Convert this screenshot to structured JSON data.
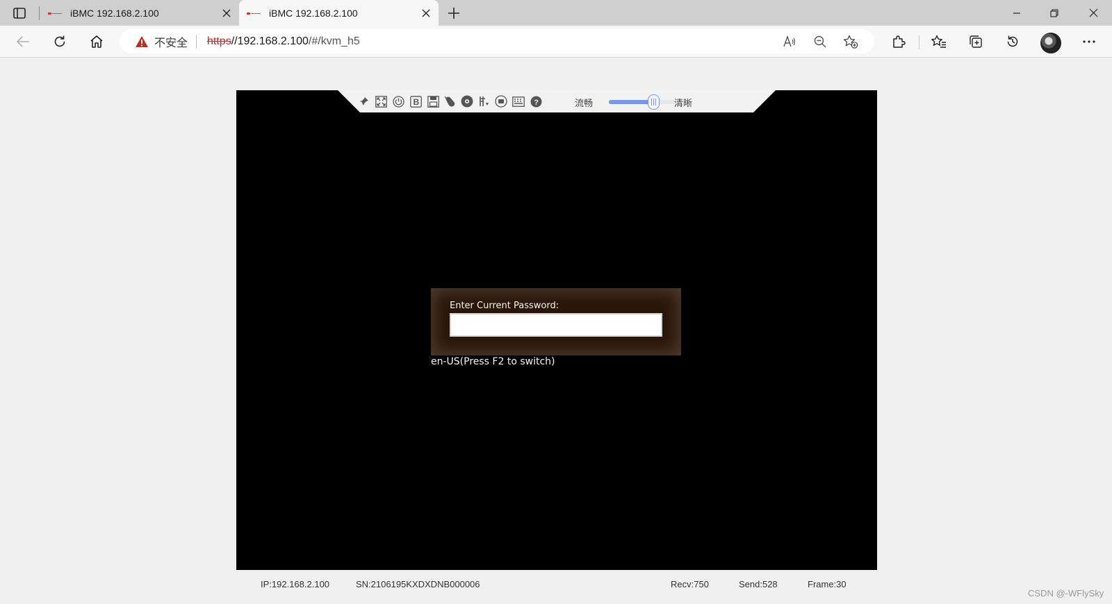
{
  "browser": {
    "tabs": [
      {
        "title": "iBMC 192.168.2.100",
        "active": false
      },
      {
        "title": "iBMC 192.168.2.100",
        "active": true
      }
    ],
    "address": {
      "security_label": "不安全",
      "url_scheme": "https",
      "url_host": "//192.168.2.100",
      "url_path": "/#/kvm_h5"
    }
  },
  "kvm": {
    "toolbar": {
      "icons": [
        "pin-icon",
        "fullscreen-icon",
        "power-icon",
        "boot-option-icon",
        "floppy-icon",
        "mouse-icon",
        "cd-icon",
        "screen-capture-icon",
        "record-icon",
        "keyboard-icon",
        "help-icon"
      ],
      "quality_left_label": "流畅",
      "quality_right_label": "清晰",
      "quality_level_percent": 67
    },
    "screen": {
      "password_prompt": "Enter Current Password:",
      "password_value": "",
      "language_hint": "en-US(Press F2 to switch)"
    },
    "status": {
      "ip": "IP:192.168.2.100",
      "sn": "SN:2106195KXDXDNB000006",
      "recv": "Recv:750",
      "send": "Send:528",
      "frame": "Frame:30"
    }
  },
  "watermark": "CSDN @-WFlySky",
  "colors": {
    "warning": "#c42b1c",
    "slider_accent": "#7a96e6",
    "kvm_background": "#000000",
    "prompt_background": "#2a1608"
  }
}
